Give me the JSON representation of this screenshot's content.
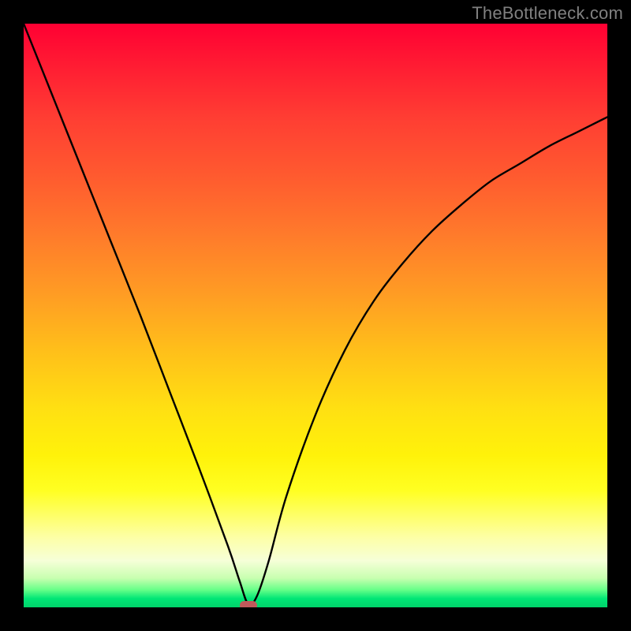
{
  "watermark": "TheBottleneck.com",
  "chart_data": {
    "type": "line",
    "title": "",
    "xlabel": "",
    "ylabel": "",
    "xlim": [
      0,
      100
    ],
    "ylim": [
      0,
      100
    ],
    "grid": false,
    "series": [
      {
        "name": "curve",
        "x": [
          0,
          5,
          10,
          15,
          20,
          25,
          30,
          35,
          37,
          38.5,
          40,
          42,
          45,
          50,
          55,
          60,
          65,
          70,
          75,
          80,
          85,
          90,
          95,
          100
        ],
        "y": [
          100,
          87.5,
          75,
          62.5,
          50,
          37,
          24,
          10.5,
          4.5,
          0.5,
          2,
          8,
          19,
          33,
          44,
          52.5,
          59,
          64.5,
          69,
          73,
          76,
          79,
          81.5,
          84
        ]
      }
    ],
    "annotations": [
      {
        "name": "minimum-marker",
        "x": 38.5,
        "y": 0.3,
        "color": "#c1595b",
        "shape": "pill"
      }
    ],
    "gradient_stops": [
      {
        "pos": 0.0,
        "color": "#ff0033"
      },
      {
        "pos": 0.26,
        "color": "#ff5a2f"
      },
      {
        "pos": 0.56,
        "color": "#ffbf1a"
      },
      {
        "pos": 0.8,
        "color": "#ffff22"
      },
      {
        "pos": 0.95,
        "color": "#c8ffb0"
      },
      {
        "pos": 1.0,
        "color": "#00d36a"
      }
    ]
  }
}
